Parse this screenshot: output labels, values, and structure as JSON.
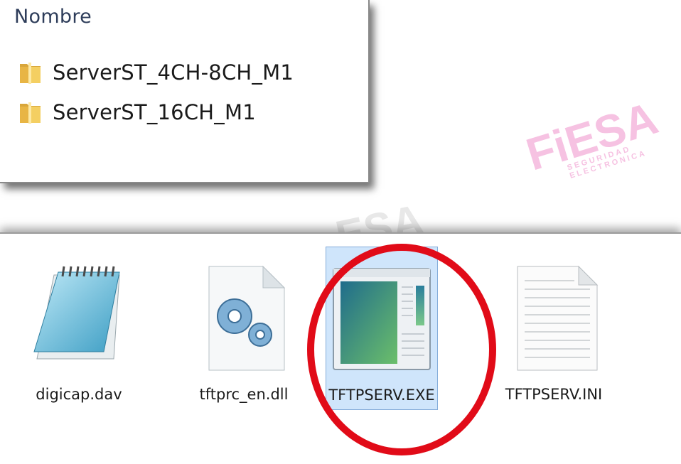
{
  "explorer_list": {
    "column_header": "Nombre",
    "folders": [
      {
        "name": "ServerST_4CH-8CH_M1",
        "icon": "folder-icon"
      },
      {
        "name": "ServerST_16CH_M1",
        "icon": "folder-icon"
      }
    ]
  },
  "file_icons": {
    "items": [
      {
        "name": "digicap.dav",
        "icon": "notepad-icon",
        "selected": false
      },
      {
        "name": "tftprc_en.dll",
        "icon": "dll-gear-icon",
        "selected": false
      },
      {
        "name": "TFTPSERV.EXE",
        "icon": "exe-window-icon",
        "selected": true
      },
      {
        "name": "TFTPSERV.INI",
        "icon": "text-file-icon",
        "selected": false
      }
    ]
  },
  "watermark": {
    "brand": "FiESA",
    "tagline": "SEGURIDAD ELECTRONICA",
    "color": "#ec78be"
  },
  "highlight": {
    "color": "#e10b18"
  }
}
